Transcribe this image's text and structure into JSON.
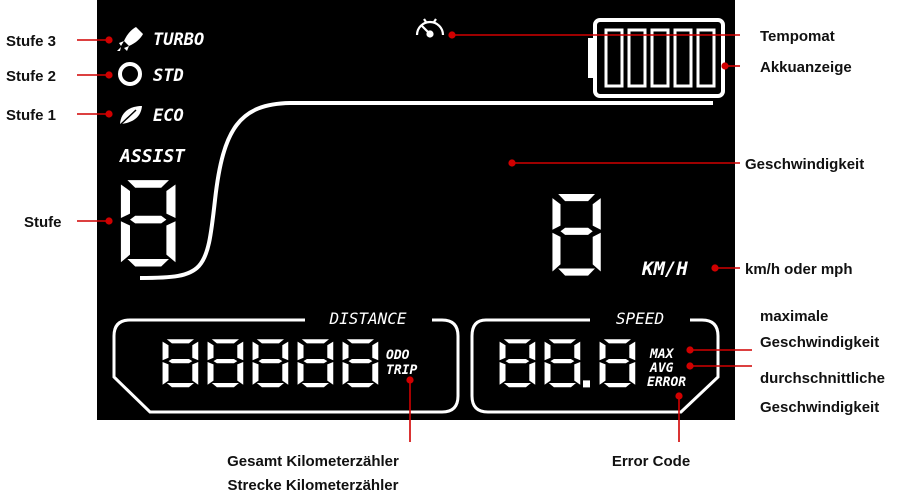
{
  "display": {
    "modes": {
      "turbo": "TURBO",
      "std": "STD",
      "eco": "ECO"
    },
    "assist_label": "ASSIST",
    "distance_label": "DISTANCE",
    "speed_label": "SPEED",
    "odo": "ODO",
    "trip": "TRIP",
    "max": "MAX",
    "avg": "AVG",
    "error": "ERROR",
    "unit": "KM/H",
    "assist_digit": "8",
    "speed_digit": "8",
    "odometer_digits": "88888",
    "speed_box_digits": "88.8",
    "battery_bars": 5,
    "colors": {
      "lcd_background": "#000000",
      "lcd_segments": "#ffffff",
      "callout": "#d10000"
    }
  },
  "labels": {
    "stufe3": "Stufe 3",
    "stufe2": "Stufe 2",
    "stufe1": "Stufe 1",
    "stufe": "Stufe",
    "tempomat": "Tempomat",
    "akku": "Akkuanzeige",
    "geschwindigkeit": "Geschwindigkeit",
    "kmh": "km/h oder mph",
    "max_line1": "maximale",
    "max_line2": "Geschwindigkeit",
    "avg_line1": "durchschnittliche",
    "avg_line2": "Geschwindigkeit",
    "gesamt": "Gesamt Kilometerzähler",
    "strecke": "Strecke Kilometerzähler",
    "error_code": "Error Code"
  }
}
